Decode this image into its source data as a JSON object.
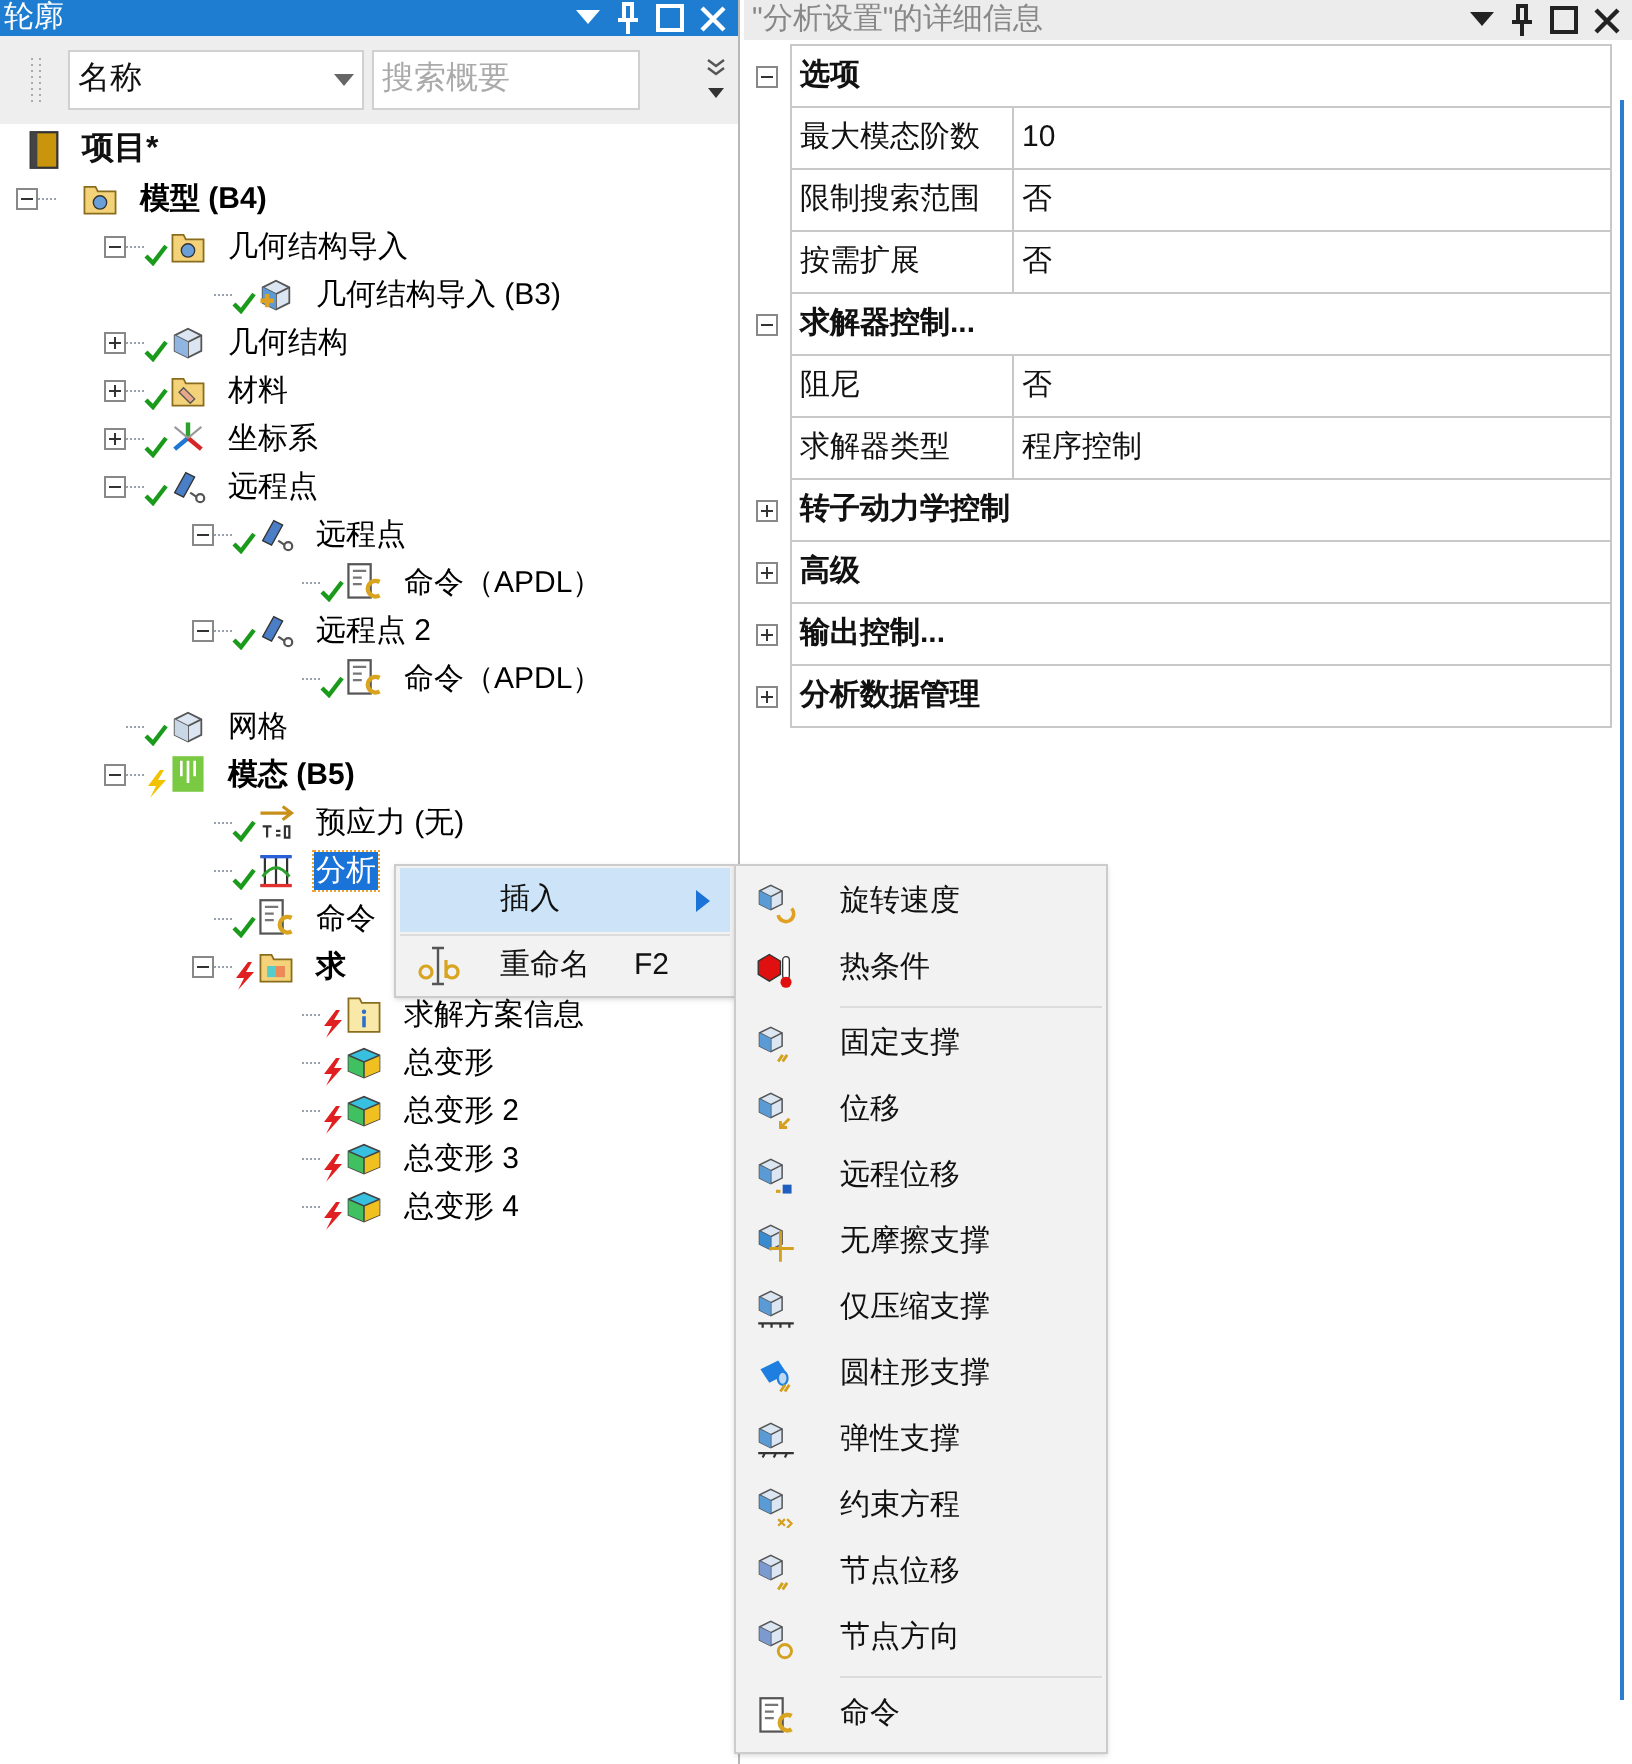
{
  "outline": {
    "title": "轮廓",
    "toolbar": {
      "column_dropdown": "名称",
      "search": {
        "placeholder": "搜索概要"
      }
    },
    "tree": {
      "label": "项目*",
      "kind": "project",
      "children": [
        {
          "label": "模型 (B4)",
          "kind": "model",
          "bold": true,
          "expanded": true,
          "selected": false,
          "children": [
            {
              "label": "几何结构导入",
              "kind": "geometry-import",
              "complete": true,
              "failed": false,
              "expanded": true,
              "selected": false,
              "children": [
                {
                  "label": "几何结构导入 (B3)",
                  "kind": "geometry-file",
                  "complete": true,
                  "failed": false,
                  "selected": false
                }
              ]
            },
            {
              "label": "几何结构",
              "kind": "geometry",
              "complete": true,
              "failed": false,
              "expanded": false,
              "selected": false
            },
            {
              "label": "材料",
              "kind": "materials",
              "complete": true,
              "failed": false,
              "expanded": false,
              "selected": false
            },
            {
              "label": "坐标系",
              "kind": "axes",
              "complete": true,
              "failed": false,
              "expanded": false,
              "selected": false
            },
            {
              "label": "远程点",
              "kind": "remote-point",
              "complete": true,
              "failed": false,
              "expanded": true,
              "selected": false,
              "children": [
                {
                  "label": "远程点",
                  "kind": "remote-point",
                  "complete": true,
                  "failed": false,
                  "expanded": true,
                  "selected": false,
                  "children": [
                    {
                      "label": "命令（APDL）",
                      "kind": "command",
                      "complete": true,
                      "failed": false,
                      "selected": false
                    }
                  ]
                },
                {
                  "label": "远程点 2",
                  "kind": "remote-point",
                  "complete": true,
                  "failed": false,
                  "expanded": true,
                  "selected": false,
                  "children": [
                    {
                      "label": "命令（APDL）",
                      "kind": "command",
                      "complete": true,
                      "failed": false,
                      "selected": false
                    }
                  ]
                }
              ]
            },
            {
              "label": "网格",
              "kind": "mesh",
              "complete": true,
              "failed": false,
              "selected": false
            },
            {
              "label": "模态 (B5)",
              "kind": "modal",
              "bold": true,
              "complete": false,
              "failed": false,
              "expanded": true,
              "selected": false,
              "children": [
                {
                  "label": "预应力 (无)",
                  "kind": "prestress",
                  "complete": true,
                  "failed": false,
                  "selected": false
                },
                {
                  "label": "分析",
                  "kind": "analysis-settings",
                  "complete": true,
                  "failed": false,
                  "selected": true
                },
                {
                  "label": "命令",
                  "kind": "command",
                  "complete": true,
                  "failed": false,
                  "selected": false
                },
                {
                  "label": "求",
                  "kind": "solution",
                  "bold": true,
                  "complete": false,
                  "failed": true,
                  "expanded": true,
                  "selected": false,
                  "children": [
                    {
                      "label": "求解方案信息",
                      "kind": "solution-info",
                      "complete": false,
                      "failed": true,
                      "selected": false
                    },
                    {
                      "label": "总变形",
                      "kind": "result",
                      "complete": false,
                      "failed": true,
                      "selected": false
                    },
                    {
                      "label": "总变形 2",
                      "kind": "result",
                      "complete": false,
                      "failed": true,
                      "selected": false
                    },
                    {
                      "label": "总变形 3",
                      "kind": "result",
                      "complete": false,
                      "failed": true,
                      "selected": false
                    },
                    {
                      "label": "总变形 4",
                      "kind": "result",
                      "complete": false,
                      "failed": true,
                      "selected": false
                    }
                  ]
                }
              ]
            }
          ]
        }
      ]
    }
  },
  "details": {
    "title": "\"分析设置\"的详细信息",
    "groups": [
      {
        "label": "选项",
        "expanded": true,
        "rows": [
          {
            "label": "最大模态阶数",
            "value": "10"
          },
          {
            "label": "限制搜索范围",
            "value": "否"
          },
          {
            "label": "按需扩展",
            "value": "否"
          }
        ]
      },
      {
        "label": "求解器控制...",
        "expanded": true,
        "rows": [
          {
            "label": "阻尼",
            "value": "否"
          },
          {
            "label": "求解器类型",
            "value": "程序控制"
          }
        ]
      },
      {
        "label": "转子动力学控制",
        "expanded": false
      },
      {
        "label": "高级",
        "expanded": false
      },
      {
        "label": "输出控制...",
        "expanded": false
      },
      {
        "label": "分析数据管理",
        "expanded": false
      }
    ]
  },
  "context_menu": {
    "items": [
      {
        "label": "插入",
        "kind": "submenu",
        "selected": true
      },
      {
        "label": "重命名",
        "kind": "rename",
        "shortcut": "F2",
        "selected": false
      }
    ]
  },
  "submenu": {
    "groups": [
      {
        "items": [
          {
            "label": "旋转速度",
            "kind": "rotation"
          },
          {
            "label": "热条件",
            "kind": "thermal"
          }
        ]
      },
      {
        "items": [
          {
            "label": "固定支撑",
            "kind": "fixed"
          },
          {
            "label": "位移",
            "kind": "displacement"
          },
          {
            "label": "远程位移",
            "kind": "remote-displacement"
          },
          {
            "label": "无摩擦支撑",
            "kind": "frictionless"
          },
          {
            "label": "仅压缩支撑",
            "kind": "compression-only"
          },
          {
            "label": "圆柱形支撑",
            "kind": "cylindrical"
          },
          {
            "label": "弹性支撑",
            "kind": "elastic"
          },
          {
            "label": "约束方程",
            "kind": "constraint"
          },
          {
            "label": "节点位移",
            "kind": "nodal-displacement"
          },
          {
            "label": "节点方向",
            "kind": "nodal-orientation"
          }
        ]
      },
      {
        "items": [
          {
            "label": "命令",
            "kind": "command"
          }
        ]
      }
    ]
  }
}
